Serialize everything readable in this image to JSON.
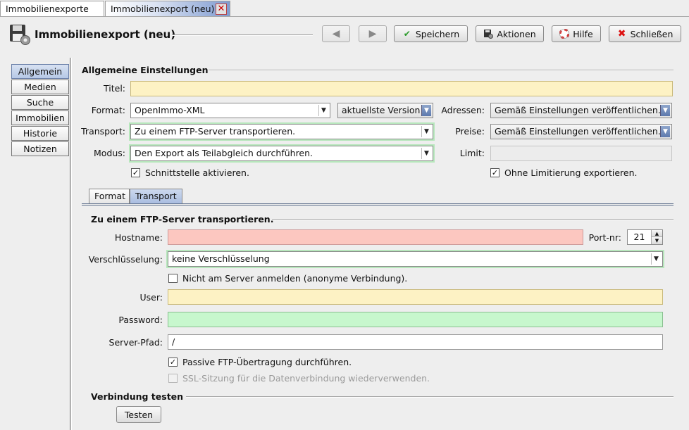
{
  "doc_tabs": [
    {
      "label": "Immobilienexporte"
    },
    {
      "label": "Immobilienexport (neu)"
    }
  ],
  "header": {
    "title": "Immobilienexport (neu)",
    "buttons": {
      "save": "Speichern",
      "actions": "Aktionen",
      "help": "Hilfe",
      "close": "Schließen"
    }
  },
  "sidebar": {
    "items": [
      {
        "label": "Allgemein"
      },
      {
        "label": "Medien"
      },
      {
        "label": "Suche"
      },
      {
        "label": "Immobilien"
      },
      {
        "label": "Historie"
      },
      {
        "label": "Notizen"
      }
    ]
  },
  "general": {
    "section_title": "Allgemeine Einstellungen",
    "title_label": "Titel:",
    "title_value": "",
    "format_label": "Format:",
    "format_value": "OpenImmo-XML",
    "version_value": "aktuellste Version",
    "transport_label": "Transport:",
    "transport_value": "Zu einem FTP-Server transportieren.",
    "mode_label": "Modus:",
    "mode_value": "Den Export als Teilabgleich durchführen.",
    "addresses_label": "Adressen:",
    "addresses_value": "Gemäß Einstellungen veröffentlichen.",
    "prices_label": "Preise:",
    "prices_value": "Gemäß Einstellungen veröffentlichen.",
    "limit_label": "Limit:",
    "limit_value": "",
    "interface_active": "Schnittstelle aktivieren.",
    "no_limit": "Ohne Limitierung exportieren."
  },
  "tabs": [
    {
      "label": "Format"
    },
    {
      "label": "Transport"
    }
  ],
  "transport": {
    "section_title": "Zu einem FTP-Server transportieren.",
    "hostname_label": "Hostname:",
    "hostname_value": "",
    "port_label": "Port-nr:",
    "port_value": "21",
    "encryption_label": "Verschlüsselung:",
    "encryption_value": "keine Verschlüsselung",
    "anonymous": "Nicht am Server anmelden (anonyme Verbindung).",
    "user_label": "User:",
    "user_value": "",
    "password_label": "Password:",
    "password_value": "",
    "path_label": "Server-Pfad:",
    "path_value": "/",
    "passive": "Passive FTP-Übertragung durchführen.",
    "ssl_reuse": "SSL-Sitzung für die Datenverbindung wiederverwenden."
  },
  "test": {
    "section_title": "Verbindung testen",
    "button": "Testen"
  },
  "checks": {
    "check_mark": "✓"
  },
  "colors": {
    "required_yellow": "#fdf2c4",
    "error_red": "#fcc7c0",
    "valid_green": "#c7f7cd",
    "accent_blue": "#7f9bd0"
  }
}
